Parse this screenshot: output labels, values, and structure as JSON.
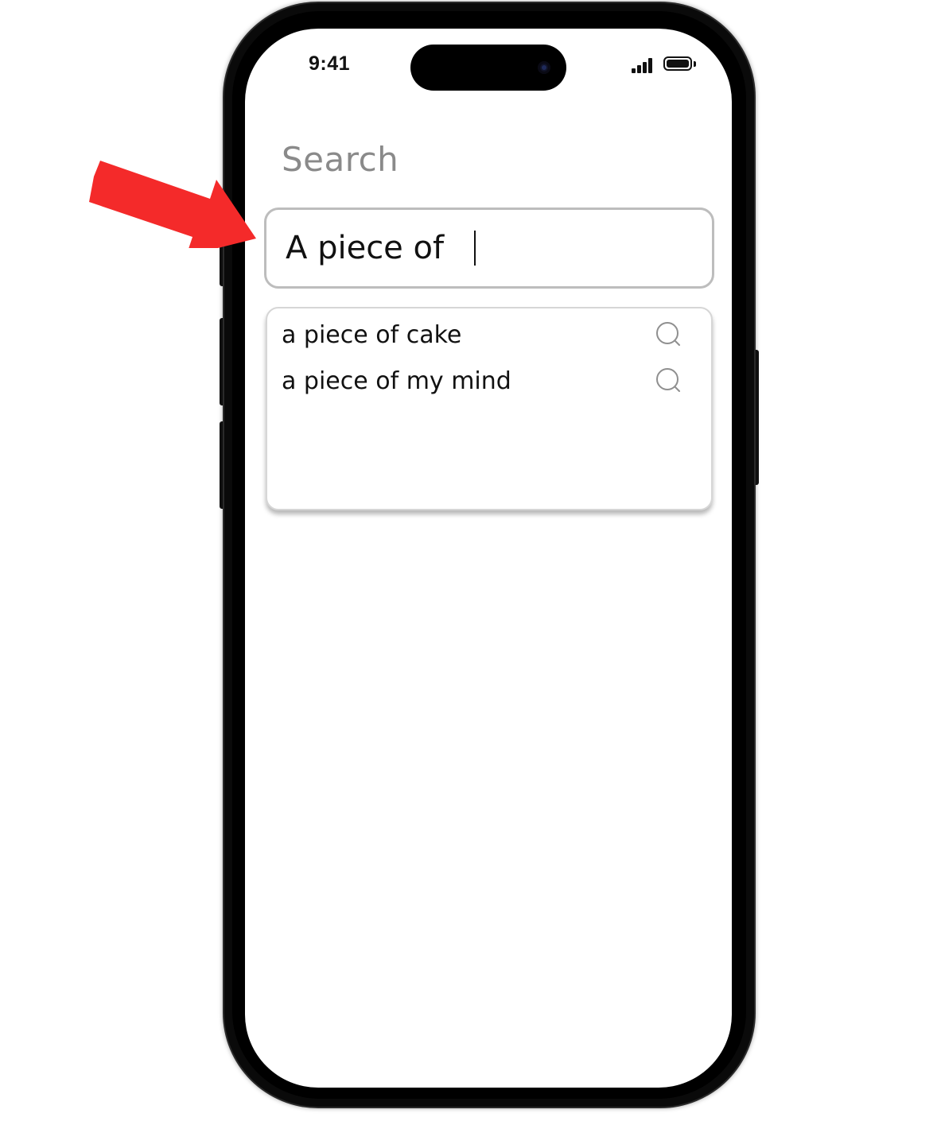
{
  "status_bar": {
    "time": "9:41",
    "icons": [
      "cellular-signal-icon",
      "battery-icon"
    ]
  },
  "screen": {
    "title": "Search",
    "search_input": {
      "value": "A piece of"
    },
    "suggestions": [
      {
        "label": "a piece of cake",
        "icon": "search-icon"
      },
      {
        "label": "a piece of my mind",
        "icon": "search-icon"
      }
    ]
  },
  "annotation": {
    "type": "red-arrow-pointer",
    "color": "#f42a2a"
  },
  "colors": {
    "title_gray": "#8a8a8a",
    "input_border": "#bdbdbd",
    "text": "#111111"
  }
}
